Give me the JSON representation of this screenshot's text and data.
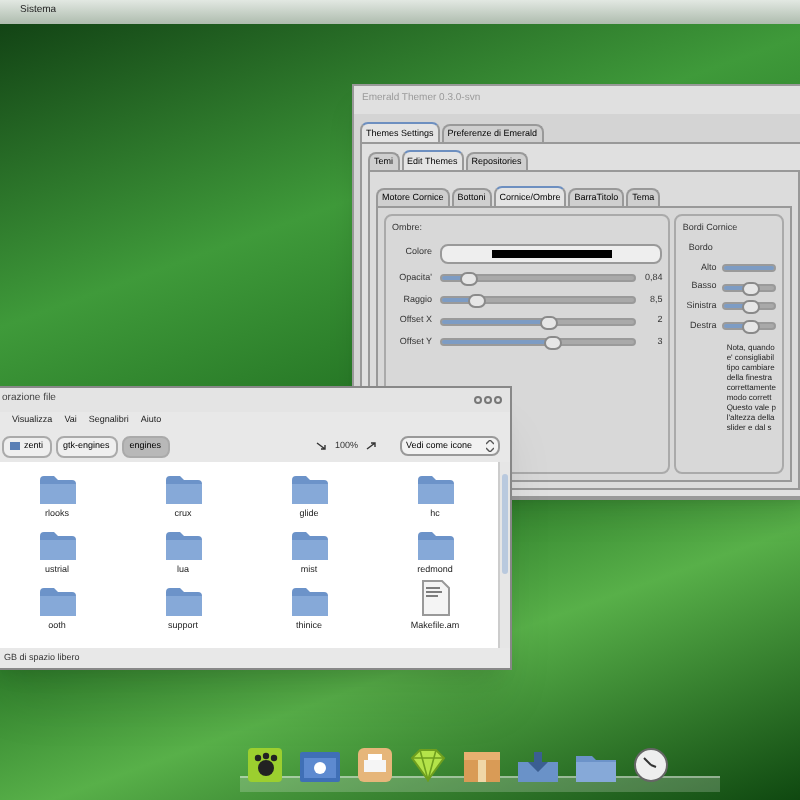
{
  "top_panel": {
    "menus": [
      "Sistema"
    ]
  },
  "themer_window": {
    "title": "Emerald Themer 0.3.0-svn",
    "tabs": [
      {
        "label": "Themes Settings",
        "selected": true
      },
      {
        "label": "Preferenze di Emerald",
        "selected": false
      }
    ],
    "subtabs": [
      {
        "label": "Temi",
        "selected": false
      },
      {
        "label": "Edit Themes",
        "selected": true
      },
      {
        "label": "Repositories",
        "selected": false
      }
    ],
    "section_tabs": [
      {
        "label": "Motore Cornice",
        "selected": false
      },
      {
        "label": "Bottoni",
        "selected": false
      },
      {
        "label": "Cornice/Ombre",
        "selected": true
      },
      {
        "label": "BarraTitolo",
        "selected": false
      },
      {
        "label": "Tema",
        "selected": false
      }
    ],
    "shadow_group": {
      "title": "Ombre:",
      "color_label": "Colore",
      "color": "#000000",
      "sliders": [
        {
          "label": "Opacita'",
          "level": 0.13,
          "reading": "0,84"
        },
        {
          "label": "Raggio",
          "level": 0.18,
          "reading": "8,5"
        },
        {
          "label": "Offset X",
          "level": 0.55,
          "reading": "2"
        },
        {
          "label": "Offset Y",
          "level": 0.57,
          "reading": "3"
        }
      ]
    },
    "borders_group": {
      "title": "Bordi Cornice",
      "subtitle": "Bordo",
      "sliders": [
        {
          "label": "Alto",
          "level": 1
        },
        {
          "label": "Basso",
          "level": 0.5
        },
        {
          "label": "Sinistra",
          "level": 0.5
        },
        {
          "label": "Destra",
          "level": 0.5
        }
      ],
      "note": [
        "Nota, quando",
        "e' consigliabil",
        "tipo cambiare",
        "della finestra",
        "correttamente",
        "modo corrett",
        "Questo vale p",
        "l'altezza della",
        "slider e dal s"
      ]
    }
  },
  "file_window": {
    "title": "orazione file",
    "menus": [
      "Visualizza",
      "Vai",
      "Segnalibri",
      "Aiuto"
    ],
    "path": [
      {
        "label": "zenti",
        "selected": false
      },
      {
        "label": "gtk-engines",
        "selected": false
      },
      {
        "label": "engines",
        "selected": true
      }
    ],
    "zoom": "100%",
    "view": "Vedi come icone",
    "items": [
      {
        "name": "rlooks",
        "kind": "folder"
      },
      {
        "name": "crux",
        "kind": "folder"
      },
      {
        "name": "glide",
        "kind": "folder"
      },
      {
        "name": "hc",
        "kind": "folder"
      },
      {
        "name": "ustrial",
        "kind": "folder"
      },
      {
        "name": "lua",
        "kind": "folder"
      },
      {
        "name": "mist",
        "kind": "folder"
      },
      {
        "name": "redmond",
        "kind": "folder"
      },
      {
        "name": "ooth",
        "kind": "folder"
      },
      {
        "name": "support",
        "kind": "folder"
      },
      {
        "name": "thinice",
        "kind": "folder"
      },
      {
        "name": "Makefile.am",
        "kind": "file"
      }
    ],
    "status": "GB di spazio libero"
  }
}
